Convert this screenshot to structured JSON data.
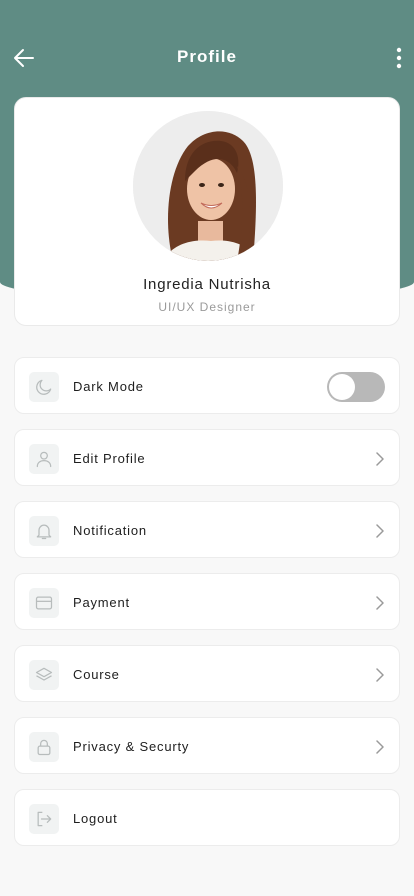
{
  "header": {
    "title": "Profile",
    "color": "#5f8c84"
  },
  "profile": {
    "name": "Ingredia Nutrisha",
    "role": "UI/UX Designer"
  },
  "menu": {
    "items": [
      {
        "label": "Dark Mode",
        "icon": "moon-icon",
        "control": "toggle",
        "toggle_on": false
      },
      {
        "label": "Edit Profile",
        "icon": "user-icon",
        "control": "chevron"
      },
      {
        "label": "Notification",
        "icon": "bell-icon",
        "control": "chevron"
      },
      {
        "label": "Payment",
        "icon": "card-icon",
        "control": "chevron"
      },
      {
        "label": "Course",
        "icon": "layers-icon",
        "control": "chevron"
      },
      {
        "label": "Privacy & Securty",
        "icon": "lock-icon",
        "control": "chevron"
      },
      {
        "label": "Logout",
        "icon": "logout-icon",
        "control": "none"
      }
    ]
  }
}
